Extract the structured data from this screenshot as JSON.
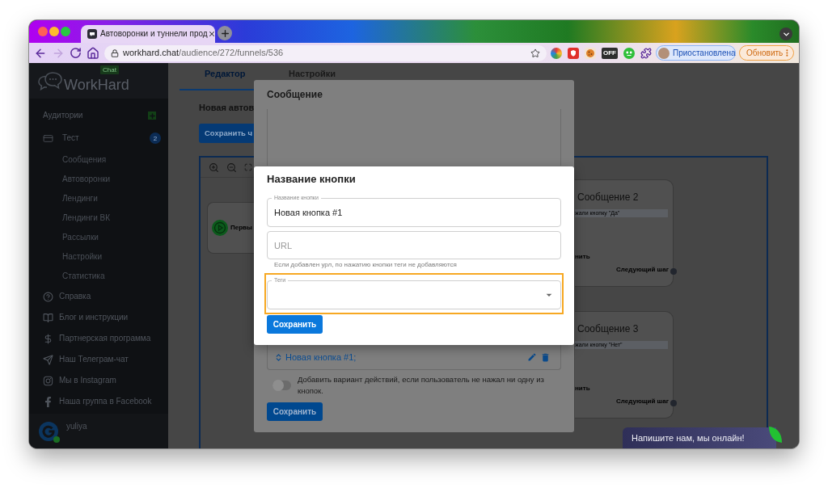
{
  "browser": {
    "tab": {
      "title": "Автоворонки и туннели прод",
      "selected": true
    },
    "forward_disabled": true,
    "address": {
      "host": "workhard.chat",
      "path": "/audience/272/funnels/536"
    },
    "extension_badge": "OFF",
    "profile": {
      "status": "Приостановлена"
    },
    "update_button": "Обновить"
  },
  "sidebar": {
    "logo": "WorkHard",
    "logo_badge": "Chat",
    "section": {
      "label": "Аудитории"
    },
    "project": {
      "label": "Тест",
      "count": "2",
      "children": [
        {
          "label": "Сообщения"
        },
        {
          "label": "Автоворонки"
        },
        {
          "label": "Лендинги"
        },
        {
          "label": "Лендинги ВК"
        },
        {
          "label": "Рассылки"
        },
        {
          "label": "Настройки"
        },
        {
          "label": "Статистика"
        }
      ]
    },
    "links": [
      {
        "label": "Справка"
      },
      {
        "label": "Блог и инструкции"
      },
      {
        "label": "Партнерская программа"
      },
      {
        "label": "Наш Телеграм-чат"
      },
      {
        "label": "Мы в Instagram"
      },
      {
        "label": "Наша группа в Facebook"
      }
    ],
    "user": {
      "name": "yuliya",
      "online": true
    }
  },
  "page": {
    "tabs": [
      {
        "label": "Редактор",
        "selected": true
      },
      {
        "label": "Настройки",
        "selected": false
      }
    ],
    "title": "Новая автов",
    "save_button": "Сохранить ч",
    "canvas": {
      "start_node": {
        "label": "Первы"
      },
      "nodes": [
        {
          "title": "Сообщение 2",
          "condition": "жали кнопку \"Да\"",
          "fragment": "нить",
          "next": "Следующий шаг"
        },
        {
          "title": "Сообщение 3",
          "condition": "жали кнопку \"Нет\"",
          "fragment": "нить",
          "next": "Следующий шаг"
        }
      ]
    }
  },
  "message_dialog": {
    "title": "Сообщение",
    "buttons": [
      {
        "label": "Новая кнопка #1;"
      }
    ],
    "fallback_toggle": {
      "label": "Добавить вариант действий, если пользователь не нажал ни одну из кнопок.",
      "on": false
    },
    "save_button": "Сохранить"
  },
  "button_dialog": {
    "title": "Название кнопки",
    "fields": [
      {
        "kind": "text",
        "label": "Название кнопки",
        "value": "Новая кнопка #1",
        "highlighted": false
      },
      {
        "kind": "text",
        "placeholder": "URL",
        "hint": "Если добавлен урл, по нажатию кнопки теги не добавляются",
        "highlighted": false
      },
      {
        "kind": "select",
        "label": "Теги",
        "highlighted": true
      }
    ],
    "save_button": "Сохранить"
  },
  "chat_widget": {
    "text": "Напишите нам, мы онлайн!"
  }
}
